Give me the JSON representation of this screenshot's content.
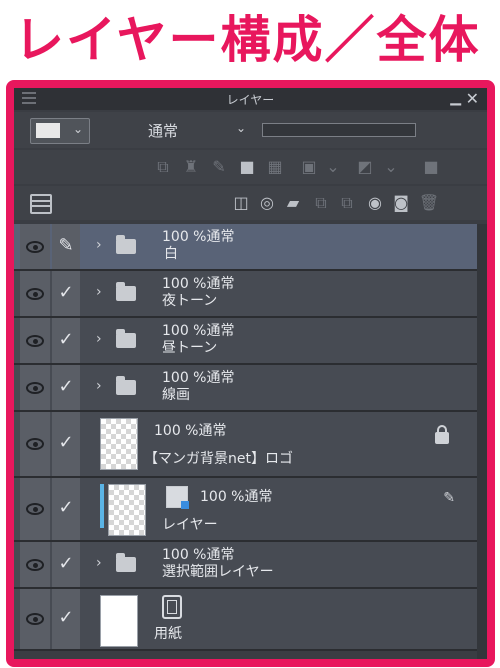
{
  "heading": "レイヤー構成／全体",
  "panel": {
    "title": "レイヤー",
    "minimize_icon": "minimize-icon",
    "close_icon": "close-icon",
    "blend_mode": "通常"
  },
  "layers": [
    {
      "line1": "100 %通常",
      "line2": "白",
      "type": "folder",
      "selected": true
    },
    {
      "line1": "100 %通常",
      "line2": "夜トーン",
      "type": "folder"
    },
    {
      "line1": "100 %通常",
      "line2": "昼トーン",
      "type": "folder"
    },
    {
      "line1": "100 %通常",
      "line2": "線画",
      "type": "folder"
    },
    {
      "line1": "100 %通常",
      "line2": "【マンガ背景net】ロゴ",
      "type": "image",
      "locked": true
    },
    {
      "line1": "100 %通常",
      "line2": "レイヤー",
      "type": "raster",
      "active": true
    },
    {
      "line1": "100 %通常",
      "line2": "選択範囲レイヤー",
      "type": "folder"
    },
    {
      "line1": "",
      "line2": "用紙",
      "type": "paper"
    }
  ]
}
